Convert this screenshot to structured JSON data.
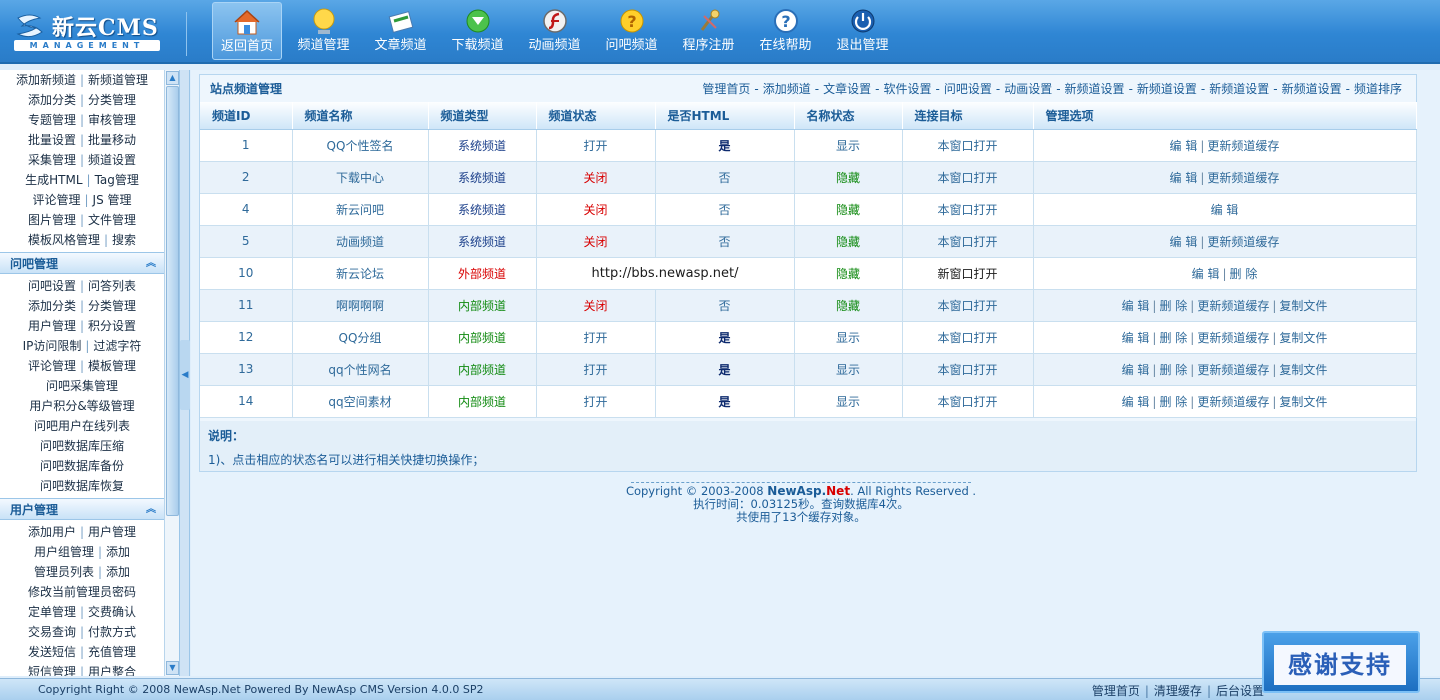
{
  "brand": {
    "title_cn": "新云",
    "title_en": "CMS",
    "subtitle": "MANAGEMENT"
  },
  "nav": [
    {
      "label": "返回首页",
      "icon": "home-icon",
      "active": true
    },
    {
      "label": "频道管理",
      "icon": "monitor-icon"
    },
    {
      "label": "文章频道",
      "icon": "article-icon"
    },
    {
      "label": "下载频道",
      "icon": "download-icon"
    },
    {
      "label": "动画频道",
      "icon": "flash-icon"
    },
    {
      "label": "问吧频道",
      "icon": "question-icon"
    },
    {
      "label": "程序注册",
      "icon": "register-icon"
    },
    {
      "label": "在线帮助",
      "icon": "help-icon"
    },
    {
      "label": "退出管理",
      "icon": "power-icon"
    }
  ],
  "sidebar": {
    "group1_rows": [
      [
        "添加新频道",
        "新频道管理"
      ],
      [
        "添加分类",
        "分类管理"
      ],
      [
        "专题管理",
        "审核管理"
      ],
      [
        "批量设置",
        "批量移动"
      ],
      [
        "采集管理",
        "频道设置"
      ],
      [
        "生成HTML",
        "Tag管理"
      ],
      [
        "评论管理",
        "JS 管理"
      ],
      [
        "图片管理",
        "文件管理"
      ],
      [
        "模板风格管理",
        "搜索"
      ]
    ],
    "group2_title": "问吧管理",
    "group2_rows": [
      [
        "问吧设置",
        "问答列表"
      ],
      [
        "添加分类",
        "分类管理"
      ],
      [
        "用户管理",
        "积分设置"
      ],
      [
        "IP访问限制",
        "过滤字符"
      ],
      [
        "评论管理",
        "模板管理"
      ],
      [
        "问吧采集管理"
      ],
      [
        "用户积分&等级管理"
      ],
      [
        "问吧用户在线列表"
      ],
      [
        "问吧数据库压缩"
      ],
      [
        "问吧数据库备份"
      ],
      [
        "问吧数据库恢复"
      ]
    ],
    "group3_title": "用户管理",
    "group3_rows": [
      [
        "添加用户",
        "用户管理"
      ],
      [
        "用户组管理",
        "添加"
      ],
      [
        "管理员列表",
        "添加"
      ],
      [
        "修改当前管理员密码"
      ],
      [
        "定单管理",
        "交费确认"
      ],
      [
        "交易查询",
        "付款方式"
      ],
      [
        "发送短信",
        "充值管理"
      ],
      [
        "短信管理",
        "用户整合"
      ]
    ]
  },
  "panel": {
    "title": "站点频道管理",
    "links": [
      "管理首页",
      "添加频道",
      "文章设置",
      "软件设置",
      "问吧设置",
      "动画设置",
      "新频道设置",
      "新频道设置",
      "新频道设置",
      "新频道设置",
      "频道排序"
    ]
  },
  "table": {
    "headers": [
      "频道ID",
      "频道名称",
      "频道类型",
      "频道状态",
      "是否HTML",
      "名称状态",
      "连接目标",
      "管理选项"
    ],
    "rows": [
      {
        "id": "1",
        "name": "QQ个性签名",
        "type": "系统频道",
        "type_kind": "sys",
        "status": "打开",
        "status_kind": "open",
        "html": "是",
        "html_kind": "yes",
        "name_status": "显示",
        "ns_kind": "show",
        "target": "本窗口打开",
        "ops": [
          "编 辑",
          "更新频道缓存"
        ]
      },
      {
        "id": "2",
        "name": "下载中心",
        "type": "系统频道",
        "type_kind": "sys",
        "status": "关闭",
        "status_kind": "closed",
        "html": "否",
        "html_kind": "no",
        "name_status": "隐藏",
        "ns_kind": "hide",
        "target": "本窗口打开",
        "ops": [
          "编 辑",
          "更新频道缓存"
        ]
      },
      {
        "id": "4",
        "name": "新云问吧",
        "type": "系统频道",
        "type_kind": "sys",
        "status": "关闭",
        "status_kind": "closed",
        "html": "否",
        "html_kind": "no",
        "name_status": "隐藏",
        "ns_kind": "hide",
        "target": "本窗口打开",
        "ops": [
          "编 辑"
        ]
      },
      {
        "id": "5",
        "name": "动画频道",
        "type": "系统频道",
        "type_kind": "sys",
        "status": "关闭",
        "status_kind": "closed",
        "html": "否",
        "html_kind": "no",
        "name_status": "隐藏",
        "ns_kind": "hide",
        "target": "本窗口打开",
        "ops": [
          "编 辑",
          "更新频道缓存"
        ]
      },
      {
        "id": "10",
        "name": "新云论坛",
        "type": "外部频道",
        "type_kind": "ext",
        "url": "http://bbs.newasp.net/",
        "name_status": "隐藏",
        "ns_kind": "hide",
        "target": "新窗口打开",
        "target_kind": "new",
        "ops": [
          "编 辑",
          "删 除"
        ]
      },
      {
        "id": "11",
        "name": "啊啊啊啊",
        "type": "内部频道",
        "type_kind": "in",
        "status": "关闭",
        "status_kind": "closed",
        "html": "否",
        "html_kind": "no",
        "name_status": "隐藏",
        "ns_kind": "hide",
        "target": "本窗口打开",
        "ops": [
          "编 辑",
          "删 除",
          "更新频道缓存",
          "复制文件"
        ]
      },
      {
        "id": "12",
        "name": "QQ分组",
        "type": "内部频道",
        "type_kind": "in",
        "status": "打开",
        "status_kind": "open",
        "html": "是",
        "html_kind": "yes",
        "name_status": "显示",
        "ns_kind": "show",
        "target": "本窗口打开",
        "ops": [
          "编 辑",
          "删 除",
          "更新频道缓存",
          "复制文件"
        ]
      },
      {
        "id": "13",
        "name": "qq个性网名",
        "type": "内部频道",
        "type_kind": "in",
        "status": "打开",
        "status_kind": "open",
        "html": "是",
        "html_kind": "yes",
        "name_status": "显示",
        "ns_kind": "show",
        "target": "本窗口打开",
        "ops": [
          "编 辑",
          "删 除",
          "更新频道缓存",
          "复制文件"
        ]
      },
      {
        "id": "14",
        "name": "qq空间素材",
        "type": "内部频道",
        "type_kind": "in",
        "status": "打开",
        "status_kind": "open",
        "html": "是",
        "html_kind": "yes",
        "name_status": "显示",
        "ns_kind": "show",
        "target": "本窗口打开",
        "ops": [
          "编 辑",
          "删 除",
          "更新频道缓存",
          "复制文件"
        ]
      }
    ]
  },
  "notes": {
    "title": "说明：",
    "line": "1)、点击相应的状态名可以进行相关快捷切换操作；"
  },
  "footer": {
    "copyright_pre": "Copyright © 2003-2008 ",
    "brand_a": "NewAsp.",
    "brand_b": "Net",
    "copyright_post": ". All Rights Reserved .",
    "exec_time": "执行时间：0.03125秒。查询数据库4次。",
    "cache": "共使用了13个缓存对象。"
  },
  "statusbar": {
    "left": "Copyright Right © 2008 NewAsp.Net Powered By NewAsp CMS Version 4.0.0 SP2",
    "links": [
      "管理首页",
      "清理缓存",
      "后台设置"
    ]
  },
  "thanks": "感谢支持",
  "colors": {
    "accent": "#2a7cc8",
    "closed": "#d80000",
    "hidden": "#108a10"
  }
}
